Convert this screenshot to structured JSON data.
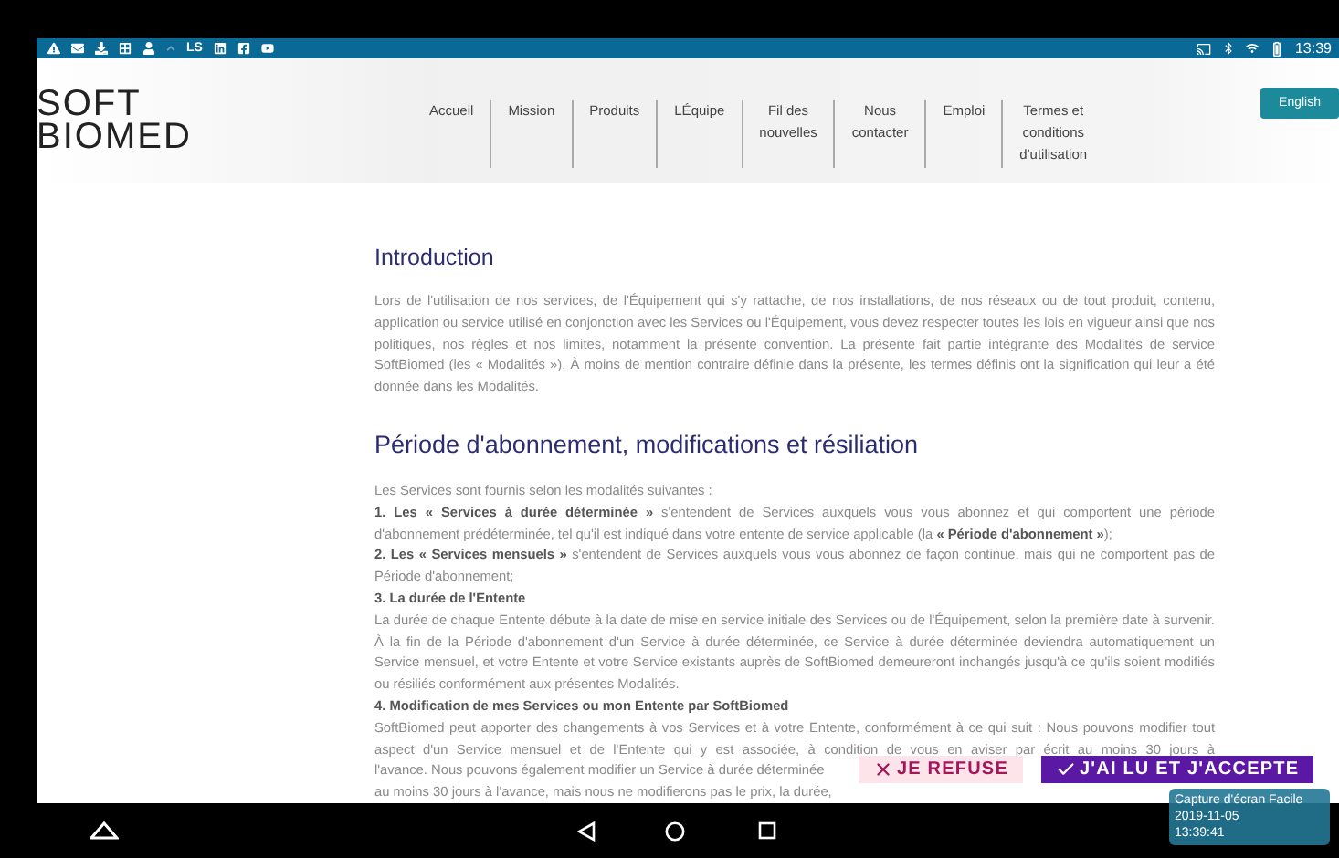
{
  "status_bar": {
    "left_label": "LS",
    "time": "13:39"
  },
  "header": {
    "logo": [
      "SOFT",
      "BIOMED"
    ],
    "menu": [
      [
        "Accueil"
      ],
      [
        "Mission"
      ],
      [
        "Produits"
      ],
      [
        "LÉquipe"
      ],
      [
        "Fil des",
        "nouvelles"
      ],
      [
        "Nous",
        "contacter"
      ],
      [
        "Emploi"
      ],
      [
        "Termes et",
        "conditions",
        "d'utilisation"
      ]
    ],
    "language_button": "English"
  },
  "sections": [
    {
      "heading": "Introduction",
      "paragraphs": [
        {
          "kind": "text",
          "text": "Lors de l'utilisation de nos services, de l'Équipement qui s'y rattache, de nos installations, de nos réseaux ou de tout produit, contenu, application ou service utilisé en conjonction avec les Services ou l'Équipement, vous devez respecter toutes les lois en vigueur ainsi que nos politiques, nos règles et nos limites, notamment la présente convention. La présente fait partie intégrante des Modalités de service SoftBiomed (les « Modalités »). À moins de mention contraire définie dans la présente, les termes définis ont la signification qui leur a été donnée dans les Modalités."
        }
      ]
    },
    {
      "heading": "Période d'abonnement, modifications et résiliation",
      "paragraphs": [
        {
          "kind": "text",
          "text": "Les Services sont fournis selon les modalités suivantes :"
        },
        {
          "kind": "text",
          "text": "**1. Les « Services à durée déterminée »** s'entendent de Services auxquels vous vous abonnez et qui comportent une période d'abonnement prédéterminée, tel qu'il est indiqué dans votre entente de service applicable (la **« Période d'abonnement »**);"
        },
        {
          "kind": "text",
          "text": "**2. Les « Services mensuels »** s'entendent de Services auxquels vous vous abonnez de façon continue, mais qui ne comportent pas de Période d'abonnement;"
        },
        {
          "kind": "subheading",
          "text": "3. La durée de l'Entente"
        },
        {
          "kind": "text",
          "text": "La durée de chaque Entente débute à la date de mise en service initiale des Services ou de l'Équipement, selon la première date à survenir. À la fin de la Période d'abonnement d'un Service à durée déterminée, ce Service à durée déterminée deviendra automatiquement un Service mensuel, et votre Entente et votre Service existants auprès de SoftBiomed demeureront inchangés jusqu'à ce qu'ils soient modifiés ou résiliés conformément aux présentes Modalités."
        },
        {
          "kind": "subheading",
          "text": "4. Modification de mes Services ou mon Entente par SoftBiomed"
        },
        {
          "kind": "continued",
          "text": "SoftBiomed peut apporter des changements à vos Services et à votre Entente, conformément à ce qui suit : Nous pouvons modifier tout aspect d'un Service mensuel et de l'Entente qui y est associée, à condition de vous en aviser par écrit au moins 30 jours à"
        },
        {
          "kind": "text",
          "text": "l'avance. Nous pouvons également modifier un Service à durée déterminée"
        },
        {
          "kind": "text",
          "text": "au moins 30 jours à l'avance, mais nous ne modifierons pas le prix, la durée,"
        }
      ]
    }
  ],
  "consent": {
    "refuse": "JE REFUSE",
    "accept": "J'AI LU ET J'ACCEPTE"
  },
  "capture_overlay": {
    "title": "Capture d'écran Facile",
    "date": "2019-11-05",
    "time": "13:39:41"
  }
}
